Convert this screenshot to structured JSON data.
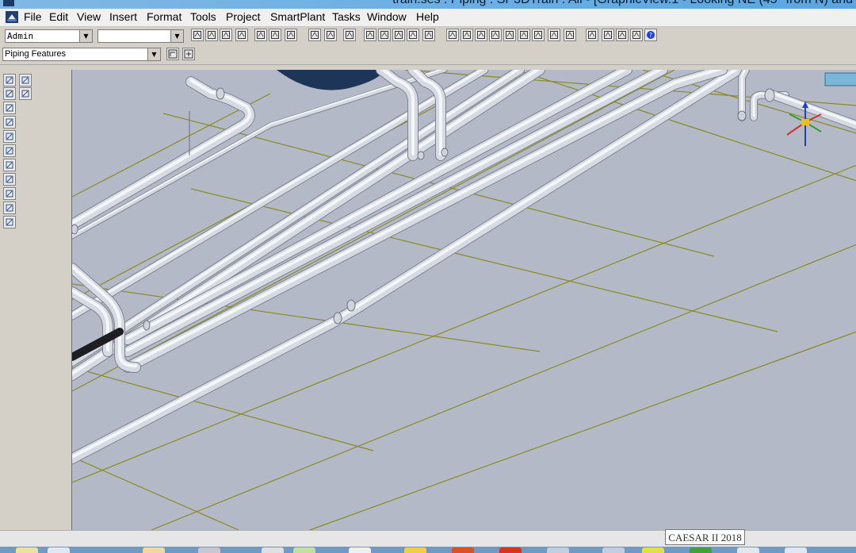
{
  "window": {
    "title": "train.ses : Piping : SP3DTrain : All - [GraphicView.1 - Looking NE (45° from N) and"
  },
  "menu": [
    "File",
    "Edit",
    "View",
    "Insert",
    "Format",
    "Tools",
    "Project",
    "SmartPlant",
    "Tasks",
    "Window",
    "Help"
  ],
  "toolbar": {
    "permission_group_value": "Admin",
    "filter_value": "",
    "features_value": "Piping Features"
  },
  "icons": {
    "main_toolbar": [
      "new-icon",
      "open-icon",
      "save-icon",
      "print-icon",
      "copy-icon",
      "paste-icon",
      "delete-icon",
      "move-icon",
      "rotate-icon",
      "undo-icon",
      "select-filter-icon",
      "properties-icon",
      "refresh-icon",
      "check-icon",
      "measure-icon",
      "render-icon",
      "view-icon",
      "grid-icon",
      "layer-icon",
      "clip-icon",
      "snap-icon",
      "window-icon",
      "zoom-icon",
      "pan-icon",
      "fit-icon",
      "area-icon",
      "rotate-view-icon",
      "named-view-icon",
      "help-icon"
    ],
    "feature_toolbar": [
      "route-pipe-icon",
      "insert-component-icon"
    ],
    "left_palette": [
      "select-icon",
      "measure-icon",
      "route-pipe-icon",
      "insert-split-icon",
      "insert-component-icon",
      "insert-tap-icon",
      "place-instrument-icon",
      "sequence-icon",
      "place-support-icon",
      "place-loop-icon",
      "place-spool-icon",
      "place-bend-icon",
      "place-weld-icon"
    ]
  },
  "status": {
    "tooltip": "CAESAR II 2018"
  },
  "colors": {
    "viewport_background": "#b4b9c8",
    "pipe": "#d6dae2",
    "grid_line": "#8a8a20",
    "title_bar": "#5aa6e0",
    "taskbar": "#6d9ac6"
  }
}
